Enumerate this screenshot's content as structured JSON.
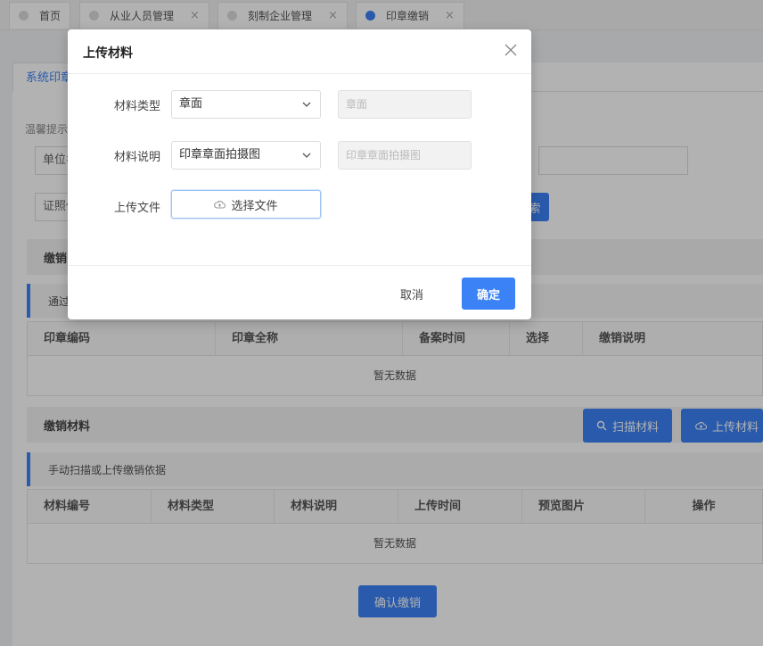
{
  "tabs": [
    {
      "label": "首页",
      "closable": false,
      "active": false
    },
    {
      "label": "从业人员管理",
      "closable": true,
      "active": false
    },
    {
      "label": "刻制企业管理",
      "closable": true,
      "active": false
    },
    {
      "label": "印章缴销",
      "closable": true,
      "active": true
    }
  ],
  "tab_close_glyph": "×",
  "page": {
    "tab_label": "系统印章",
    "hint": "温馨提示",
    "field1": "单位名",
    "field2": "证照代",
    "search_button": "索"
  },
  "section1": {
    "title": "缴销",
    "notice": "通过"
  },
  "table1": {
    "columns": [
      "印章编码",
      "印章全称",
      "备案时间",
      "选择",
      "缴销说明"
    ],
    "empty": "暂无数据"
  },
  "section2": {
    "title": "缴销材料",
    "scan_button": "扫描材料",
    "upload_button": "上传材料",
    "notice": "手动扫描或上传缴销依据"
  },
  "table2": {
    "columns": [
      "材料编号",
      "材料类型",
      "材料说明",
      "上传时间",
      "预览图片",
      "操作"
    ],
    "empty": "暂无数据"
  },
  "confirm_revoke": "确认缴销",
  "modal": {
    "title": "上传材料",
    "type_label": "材料类型",
    "type_value": "章面",
    "type_readonly": "章面",
    "desc_label": "材料说明",
    "desc_value": "印章章面拍摄图",
    "desc_readonly": "印章章面拍摄图",
    "file_label": "上传文件",
    "file_button": "选择文件",
    "cancel": "取消",
    "ok": "确定"
  },
  "colors": {
    "primary": "#3b82f6",
    "overlay": "rgba(0,0,0,0.30)"
  }
}
